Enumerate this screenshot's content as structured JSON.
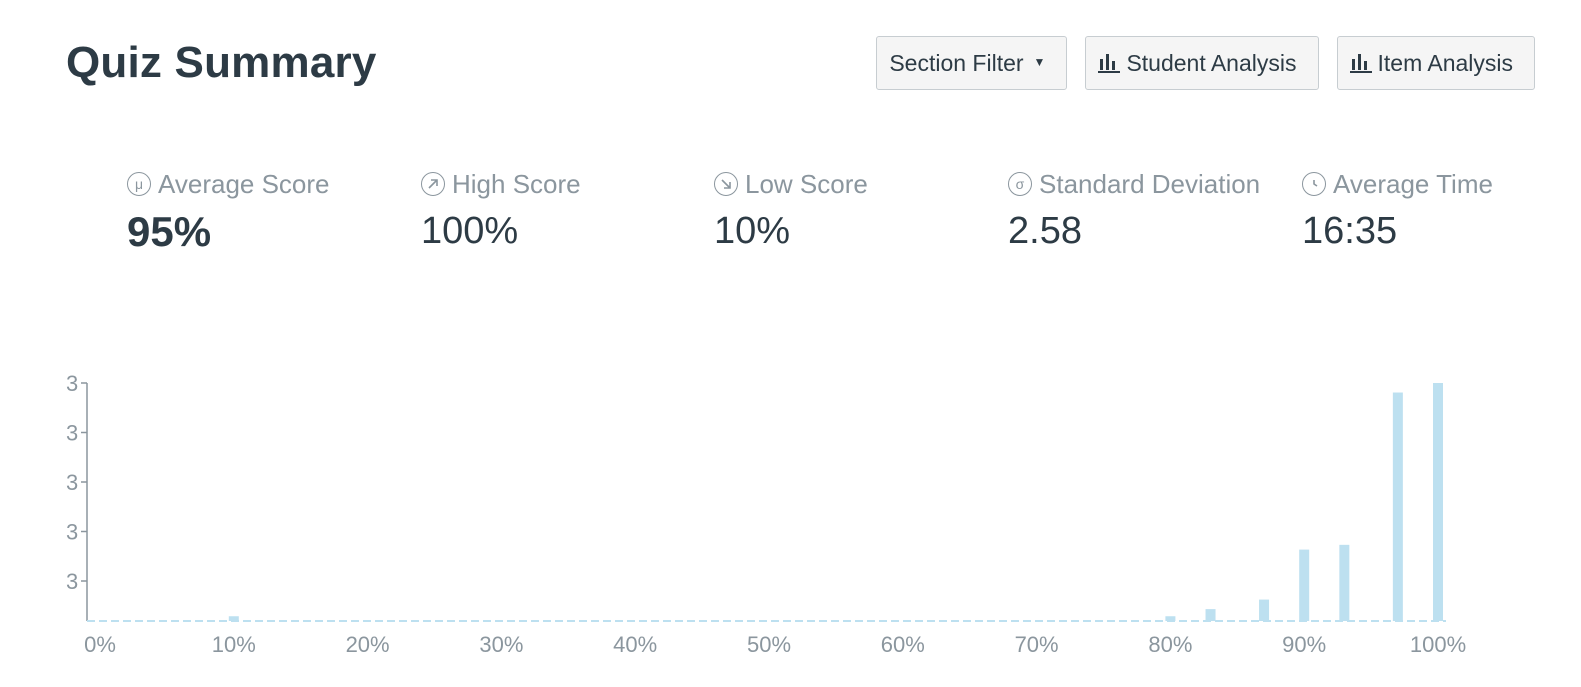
{
  "page": {
    "title": "Quiz Summary"
  },
  "toolbar": {
    "section_filter": "Section Filter",
    "student_analysis": "Student Analysis",
    "item_analysis": "Item Analysis"
  },
  "stats": {
    "average_score": {
      "label": "Average Score",
      "value": "95%",
      "icon": "mu-icon"
    },
    "high_score": {
      "label": "High Score",
      "value": "100%",
      "icon": "arrow-up-right-icon"
    },
    "low_score": {
      "label": "Low Score",
      "value": "10%",
      "icon": "arrow-down-right-icon"
    },
    "standard_deviation": {
      "label": "Standard Deviation",
      "value": "2.58",
      "icon": "sigma-icon"
    },
    "average_time": {
      "label": "Average Time",
      "value": "16:35",
      "icon": "clock-icon"
    }
  },
  "colors": {
    "bar": "#bde0f0",
    "axis": "#8b969e",
    "text": "#2d3b45",
    "muted": "#8b969e"
  },
  "chart_data": {
    "type": "bar",
    "title": "",
    "xlabel": "",
    "ylabel": "",
    "x_ticks": [
      "0%",
      "10%",
      "20%",
      "30%",
      "40%",
      "50%",
      "60%",
      "70%",
      "80%",
      "90%",
      "100%"
    ],
    "y_tick_labels": [
      "3",
      "3",
      "3",
      "3",
      "3"
    ],
    "xlim": [
      0,
      100
    ],
    "ylim": [
      0,
      100
    ],
    "grid": false,
    "points": [
      {
        "x": 10,
        "y": 2
      },
      {
        "x": 80,
        "y": 2
      },
      {
        "x": 83,
        "y": 5
      },
      {
        "x": 87,
        "y": 9
      },
      {
        "x": 90,
        "y": 30
      },
      {
        "x": 93,
        "y": 32
      },
      {
        "x": 97,
        "y": 96
      },
      {
        "x": 100,
        "y": 100
      }
    ]
  }
}
